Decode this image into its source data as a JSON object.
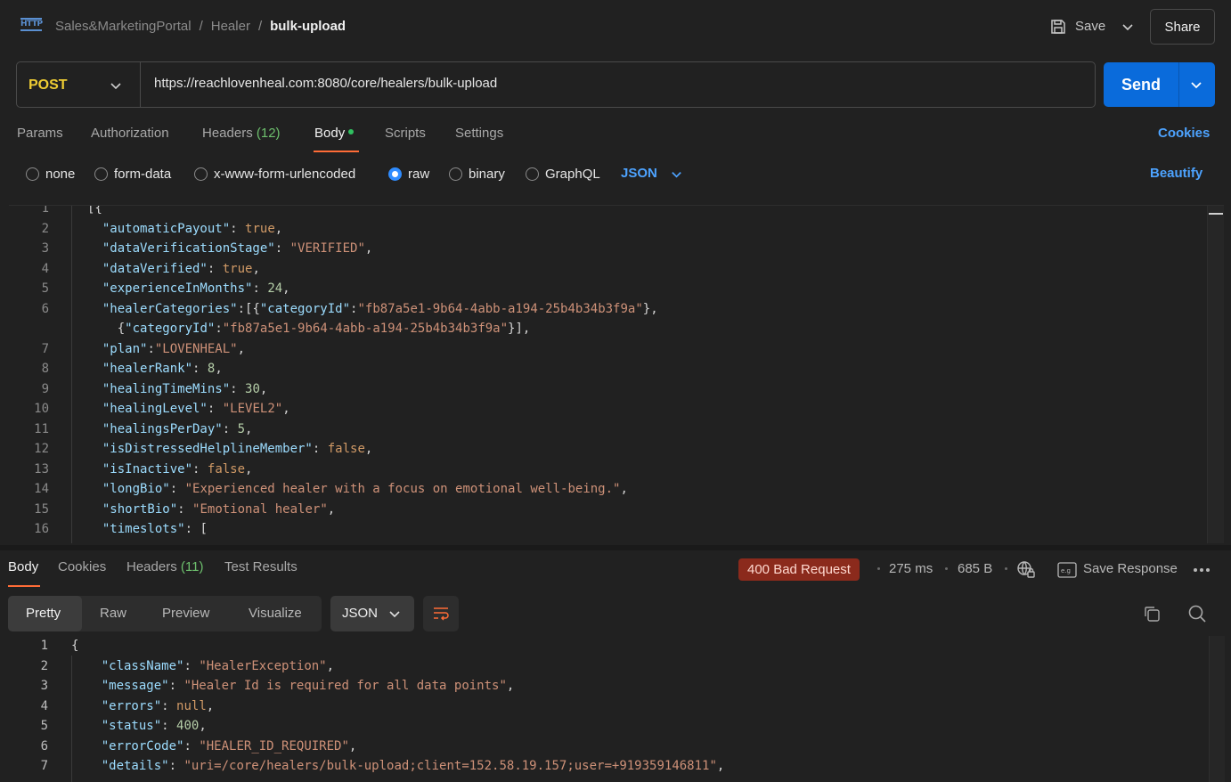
{
  "header": {
    "logo_text": "HTTP",
    "breadcrumbs": [
      "Sales&MarketingPortal",
      "Healer",
      "bulk-upload"
    ],
    "save_label": "Save",
    "share_label": "Share"
  },
  "request": {
    "method": "POST",
    "url": "https://reachlovenheal.com:8080/core/healers/bulk-upload",
    "send_label": "Send",
    "tabs": [
      {
        "label": "Params"
      },
      {
        "label": "Authorization"
      },
      {
        "label": "Headers",
        "count": "(12)"
      },
      {
        "label": "Body"
      },
      {
        "label": "Scripts"
      },
      {
        "label": "Settings"
      }
    ],
    "cookies_label": "Cookies",
    "body_types": [
      "none",
      "form-data",
      "x-www-form-urlencoded",
      "raw",
      "binary",
      "GraphQL"
    ],
    "selected_body_type": "raw",
    "format": "JSON",
    "beautify_label": "Beautify"
  },
  "request_body_lines": [
    {
      "n": "1",
      "text": "[{"
    },
    {
      "n": "2",
      "text": "  \"automaticPayout\": true,"
    },
    {
      "n": "3",
      "text": "  \"dataVerificationStage\": \"VERIFIED\","
    },
    {
      "n": "4",
      "text": "  \"dataVerified\": true,"
    },
    {
      "n": "5",
      "text": "  \"experienceInMonths\": 24,"
    },
    {
      "n": "6",
      "text": "  \"healerCategories\":[{\"categoryId\":\"fb87a5e1-9b64-4abb-a194-25b4b34b3f9a\"},"
    },
    {
      "n": "",
      "text": "    {\"categoryId\":\"fb87a5e1-9b64-4abb-a194-25b4b34b3f9a\"}],"
    },
    {
      "n": "7",
      "text": "  \"plan\":\"LOVENHEAL\","
    },
    {
      "n": "8",
      "text": "  \"healerRank\": 8,"
    },
    {
      "n": "9",
      "text": "  \"healingTimeMins\": 30,"
    },
    {
      "n": "10",
      "text": "  \"healingLevel\": \"LEVEL2\","
    },
    {
      "n": "11",
      "text": "  \"healingsPerDay\": 5,"
    },
    {
      "n": "12",
      "text": "  \"isDistressedHelplineMember\": false,"
    },
    {
      "n": "13",
      "text": "  \"isInactive\": false,"
    },
    {
      "n": "14",
      "text": "  \"longBio\": \"Experienced healer with a focus on emotional well-being.\","
    },
    {
      "n": "15",
      "text": "  \"shortBio\": \"Emotional healer\","
    },
    {
      "n": "16",
      "text": "  \"timeslots\": ["
    }
  ],
  "response": {
    "tabs": [
      {
        "label": "Body"
      },
      {
        "label": "Cookies"
      },
      {
        "label": "Headers",
        "count": "(11)"
      },
      {
        "label": "Test Results"
      }
    ],
    "status": "400 Bad Request",
    "time": "275 ms",
    "size": "685 B",
    "save_response_label": "Save Response",
    "views": [
      "Pretty",
      "Raw",
      "Preview",
      "Visualize"
    ],
    "active_view": "Pretty",
    "format": "JSON",
    "colors": {
      "status_bg": "#8b2a1c",
      "accent": "#ff6c37",
      "send": "#0a6bdb"
    }
  },
  "response_body_lines": [
    {
      "n": "1",
      "text": "{"
    },
    {
      "n": "2",
      "text": "    \"className\": \"HealerException\","
    },
    {
      "n": "3",
      "text": "    \"message\": \"Healer Id is required for all data points\","
    },
    {
      "n": "4",
      "text": "    \"errors\": null,"
    },
    {
      "n": "5",
      "text": "    \"status\": 400,"
    },
    {
      "n": "6",
      "text": "    \"errorCode\": \"HEALER_ID_REQUIRED\","
    },
    {
      "n": "7",
      "text": "    \"details\": \"uri=/core/healers/bulk-upload;client=152.58.19.157;user=+919359146811\","
    }
  ]
}
